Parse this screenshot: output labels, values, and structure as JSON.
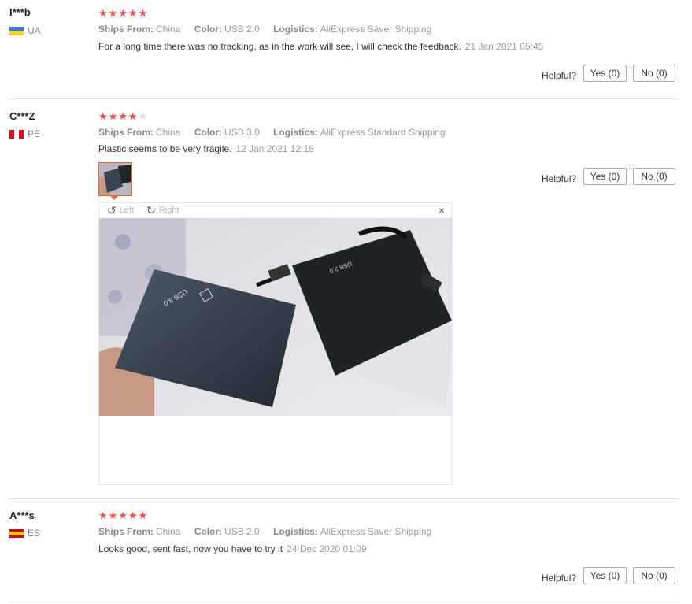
{
  "colors": {
    "star": "#f24c4c",
    "star_off": "#dddddd",
    "accent": "#e06a2c"
  },
  "helpful_label": "Helpful?",
  "labels": {
    "ships_from": "Ships From:",
    "color": "Color:",
    "logistics": "Logistics:"
  },
  "reviews": [
    {
      "user": "I***b",
      "country": "UA",
      "stars": 5,
      "ships_from": "China",
      "color": "USB 2.0",
      "logistics": "AliExpress Saver Shipping",
      "text": "For a long time there was no tracking, as in the work will see, I will check the feedback.",
      "date": "21 Jan 2021 05:45",
      "yes": "Yes (0)",
      "no": "No (0)"
    },
    {
      "user": "C***Z",
      "country": "PE",
      "stars": 4,
      "ships_from": "China",
      "color": "USB 3.0",
      "logistics": "AliExpress Standard Shipping",
      "text": "Plastic seems to be very fragile.",
      "date": "12 Jan 2021 12:18",
      "yes": "Yes (0)",
      "no": "No (0)",
      "viewer": {
        "left": "Left",
        "right": "Right",
        "close": "×"
      },
      "drive_label": "USB 3.0"
    },
    {
      "user": "A***s",
      "country": "ES",
      "stars": 5,
      "ships_from": "China",
      "color": "USB 2.0",
      "logistics": "AliExpress Saver Shipping",
      "text": "Looks good, sent fast, now you have to try it",
      "date": "24 Dec 2020 01:09",
      "yes": "Yes (0)",
      "no": "No (0)"
    }
  ]
}
